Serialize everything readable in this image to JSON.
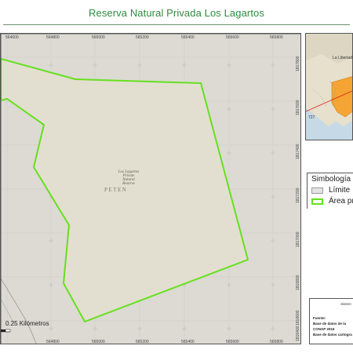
{
  "title": "Reserva Natural Privada Los Lagartos",
  "map": {
    "reserve_label_lines": [
      "Los Lagartos",
      "Private",
      "Natural",
      "Reserve"
    ],
    "region_label": "PETEN",
    "boundary_color": "#66e01e",
    "fill_color": "#e3dfd0",
    "scale_label": "0.25 Kilómetros",
    "x_ticks_top": [
      "564600",
      "564800",
      "565000",
      "565200",
      "565400",
      "565600",
      "565800"
    ],
    "x_ticks_bottom": [
      "564800",
      "565000",
      "565200",
      "565400",
      "565600",
      "565800"
    ],
    "y_ticks_right": [
      "1817800",
      "1817600",
      "1817400",
      "1817200",
      "1817000",
      "1816800",
      "1816600",
      "1816400"
    ]
  },
  "inset": {
    "place_label": "La Libertad",
    "number_label": "727",
    "highlight_color": "#f5a533"
  },
  "legend": {
    "title": "Simbología",
    "items": [
      {
        "label": "Límite",
        "swatch_fill": "#e3e3e3",
        "swatch_border": "#9a9a9a"
      },
      {
        "label": "Área pr",
        "swatch_fill": "#ffffff",
        "swatch_border": "#66e01e"
      }
    ]
  },
  "notes": {
    "title": "Sistem",
    "lines": [
      "Fuente:",
      "Base de datos de la",
      "CONAP 2016",
      "Base de datos cartogra"
    ]
  }
}
